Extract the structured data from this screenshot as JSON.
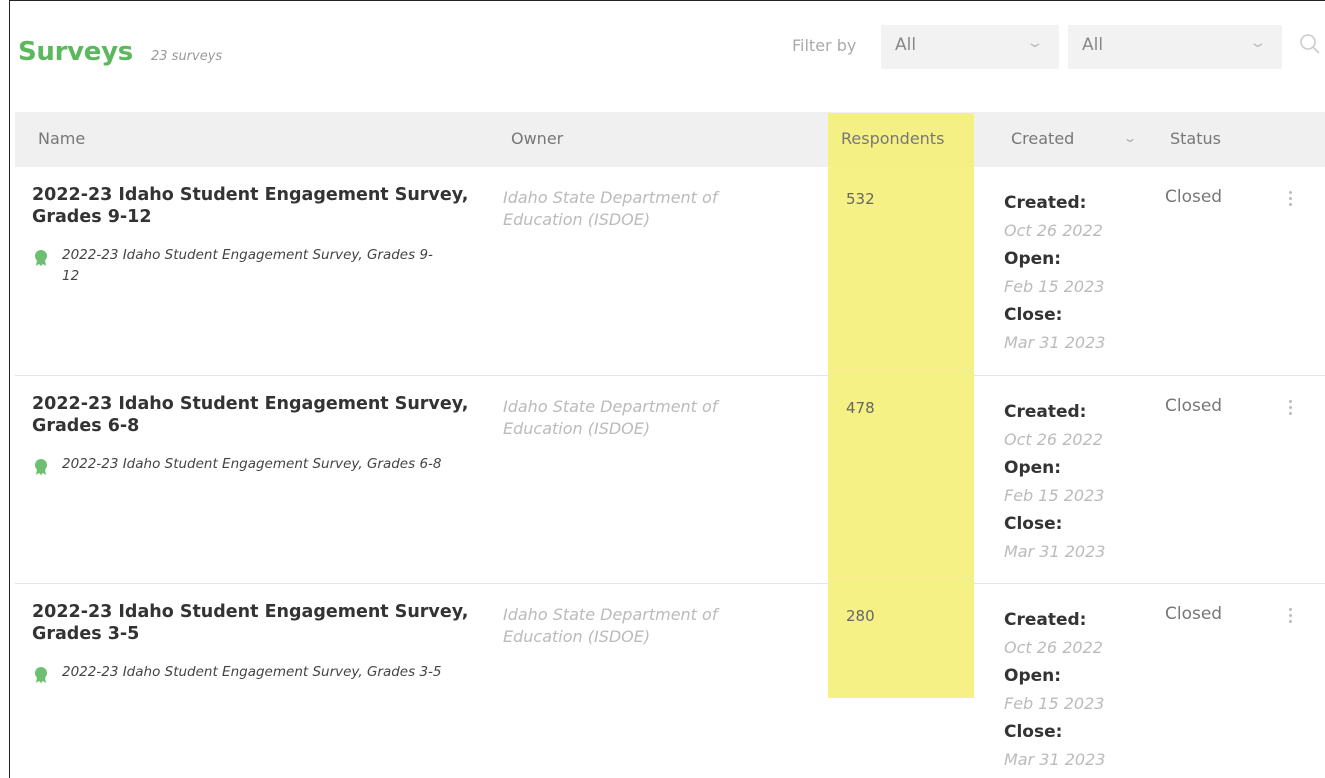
{
  "header": {
    "title": "Surveys",
    "count": "23 surveys",
    "filter_label": "Filter by",
    "filter1": {
      "value": "All",
      "icon": "chevron-down-icon"
    },
    "filter2": {
      "value": "All",
      "icon": "chevron-down-icon"
    },
    "search_icon": "search-icon"
  },
  "table": {
    "columns": {
      "name": "Name",
      "owner": "Owner",
      "respondents": "Respondents",
      "created": "Created",
      "status": "Status"
    },
    "highlight_color": "#f4f07a",
    "rows": [
      {
        "name": "2022-23 Idaho Student Engagement Survey, Grades 9-12",
        "sub": "2022-23 Idaho Student Engagement Survey, Grades 9-12",
        "owner": "Idaho State Department of Education (ISDOE)",
        "respondents": "532",
        "created_label": "Created:",
        "created": "Oct 26 2022",
        "open_label": "Open:",
        "open": "Feb 15 2023",
        "close_label": "Close:",
        "close": "Mar 31 2023",
        "status": "Closed"
      },
      {
        "name": "2022-23 Idaho Student Engagement Survey, Grades 6-8",
        "sub": "2022-23 Idaho Student Engagement Survey, Grades 6-8",
        "owner": "Idaho State Department of Education (ISDOE)",
        "respondents": "478",
        "created_label": "Created:",
        "created": "Oct 26 2022",
        "open_label": "Open:",
        "open": "Feb 15 2023",
        "close_label": "Close:",
        "close": "Mar 31 2023",
        "status": "Closed"
      },
      {
        "name": "2022-23 Idaho Student Engagement Survey, Grades 3-5",
        "sub": "2022-23 Idaho Student Engagement Survey, Grades 3-5",
        "owner": "Idaho State Department of Education (ISDOE)",
        "respondents": "280",
        "created_label": "Created:",
        "created": "Oct 26 2022",
        "open_label": "Open:",
        "open": "Feb 15 2023",
        "close_label": "Close:",
        "close": "Mar 31 2023",
        "status": "Closed"
      }
    ]
  },
  "colors": {
    "brand_green": "#5cb85c",
    "badge_green": "#6fbf73"
  }
}
